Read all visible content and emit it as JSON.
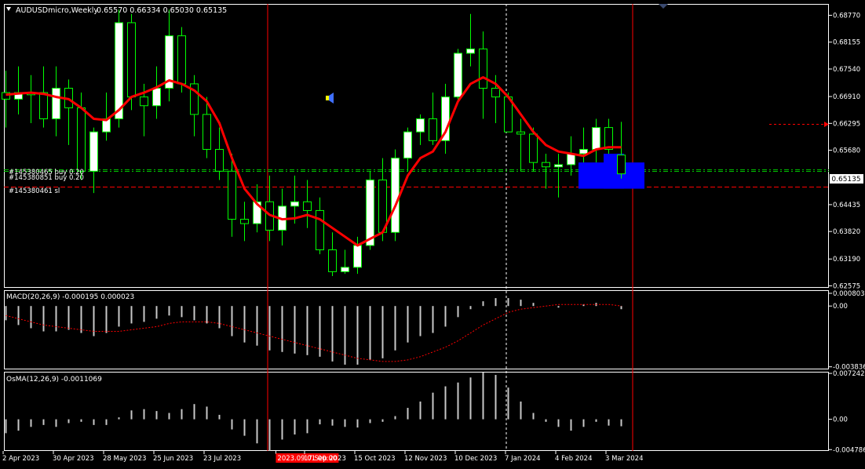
{
  "window": {
    "symbol_header": "AUDUSDmicro,Weekly",
    "ohlc_header": "0.65570 0.66334 0.65030 0.65135",
    "current_price_label": "0.65135"
  },
  "colors": {
    "background": "#000000",
    "bull_candle": "#ffffff",
    "bear_candle": "#000000",
    "wick": "#00ff00",
    "ma_line": "#ff0000",
    "histogram": "#c8c8c8",
    "signal_line": "#ff0000",
    "order_box": "#0000ff",
    "grid_dash": "#ffffff"
  },
  "orders": [
    {
      "label": "#145380465 buy 0.20",
      "price": 0.6525
    },
    {
      "label": "#145380851 buy 0.20",
      "price": 0.652
    },
    {
      "label": "#145380461 sl",
      "price": 0.6485
    }
  ],
  "chart_data": [
    {
      "type": "candlestick",
      "title": "AUDUSDmicro,Weekly",
      "y_ticks": [
        "0.68770",
        "0.68155",
        "0.67540",
        "0.66910",
        "0.66295",
        "0.65680",
        "0.64435",
        "0.63820",
        "0.63190",
        "0.62575"
      ],
      "ylim": [
        0.6253,
        0.6903
      ],
      "x_ticks": [
        "2 Apr 2023",
        "30 Apr 2023",
        "28 May 2023",
        "25 Jun 2023",
        "23 Jul 2023",
        "2023.09.01 00:00",
        "17 Sep 2023",
        "15 Oct 2023",
        "12 Nov 2023",
        "10 Dec 2023",
        "7 Jan 2024",
        "4 Feb 2024",
        "3 Mar 2024"
      ],
      "x_tick_dates": [
        "2023-04-02",
        "2023-04-30",
        "2023-05-28",
        "2023-06-25",
        "2023-07-23",
        "2023-09-01",
        "2023-09-17",
        "2023-10-15",
        "2023-11-12",
        "2023-12-10",
        "2024-01-07",
        "2024-02-04",
        "2024-03-03"
      ],
      "highlighted_x_tick": "2023.09.01 00:00",
      "current_price": 0.65135,
      "candles": [
        [
          0.67,
          0.675,
          0.662,
          0.6685
        ],
        [
          0.6685,
          0.676,
          0.665,
          0.67
        ],
        [
          0.67,
          0.674,
          0.663,
          0.6695
        ],
        [
          0.67,
          0.676,
          0.662,
          0.664
        ],
        [
          0.664,
          0.676,
          0.66,
          0.671
        ],
        [
          0.671,
          0.673,
          0.658,
          0.6665
        ],
        [
          0.6665,
          0.67,
          0.65,
          0.652
        ],
        [
          0.652,
          0.662,
          0.647,
          0.661
        ],
        [
          0.661,
          0.67,
          0.659,
          0.664
        ],
        [
          0.664,
          0.689,
          0.662,
          0.686
        ],
        [
          0.686,
          0.688,
          0.666,
          0.669
        ],
        [
          0.669,
          0.672,
          0.66,
          0.667
        ],
        [
          0.667,
          0.676,
          0.664,
          0.671
        ],
        [
          0.671,
          0.689,
          0.668,
          0.683
        ],
        [
          0.683,
          0.685,
          0.67,
          0.672
        ],
        [
          0.672,
          0.674,
          0.66,
          0.665
        ],
        [
          0.665,
          0.669,
          0.655,
          0.657
        ],
        [
          0.657,
          0.662,
          0.65,
          0.652
        ],
        [
          0.652,
          0.656,
          0.637,
          0.641
        ],
        [
          0.641,
          0.645,
          0.636,
          0.64
        ],
        [
          0.64,
          0.649,
          0.638,
          0.645
        ],
        [
          0.645,
          0.651,
          0.636,
          0.6385
        ],
        [
          0.6385,
          0.648,
          0.635,
          0.644
        ],
        [
          0.644,
          0.651,
          0.64,
          0.645
        ],
        [
          0.645,
          0.65,
          0.639,
          0.643
        ],
        [
          0.643,
          0.646,
          0.633,
          0.634
        ],
        [
          0.634,
          0.638,
          0.628,
          0.629
        ],
        [
          0.629,
          0.634,
          0.6285,
          0.63
        ],
        [
          0.63,
          0.637,
          0.6285,
          0.635
        ],
        [
          0.635,
          0.652,
          0.634,
          0.65
        ],
        [
          0.65,
          0.655,
          0.636,
          0.638
        ],
        [
          0.638,
          0.657,
          0.636,
          0.655
        ],
        [
          0.655,
          0.662,
          0.652,
          0.661
        ],
        [
          0.661,
          0.665,
          0.658,
          0.664
        ],
        [
          0.664,
          0.67,
          0.658,
          0.659
        ],
        [
          0.659,
          0.672,
          0.656,
          0.669
        ],
        [
          0.669,
          0.68,
          0.668,
          0.679
        ],
        [
          0.679,
          0.688,
          0.676,
          0.68
        ],
        [
          0.68,
          0.684,
          0.664,
          0.671
        ],
        [
          0.671,
          0.674,
          0.663,
          0.669
        ],
        [
          0.669,
          0.67,
          0.661,
          0.661
        ],
        [
          0.661,
          0.664,
          0.652,
          0.6605
        ],
        [
          0.6605,
          0.662,
          0.652,
          0.654
        ],
        [
          0.654,
          0.656,
          0.648,
          0.653
        ],
        [
          0.653,
          0.656,
          0.646,
          0.6535
        ],
        [
          0.6535,
          0.66,
          0.651,
          0.656
        ],
        [
          0.656,
          0.662,
          0.654,
          0.657
        ],
        [
          0.657,
          0.664,
          0.654,
          0.662
        ],
        [
          0.662,
          0.664,
          0.656,
          0.657
        ],
        [
          0.6557,
          0.6633,
          0.6503,
          0.6514
        ]
      ],
      "ma_series": {
        "name": "",
        "values": [
          0.6695,
          0.6698,
          0.67,
          0.6697,
          0.669,
          0.6685,
          0.6665,
          0.664,
          0.6637,
          0.666,
          0.669,
          0.67,
          0.6712,
          0.6728,
          0.672,
          0.6705,
          0.668,
          0.663,
          0.655,
          0.648,
          0.6445,
          0.642,
          0.641,
          0.6412,
          0.642,
          0.641,
          0.639,
          0.637,
          0.635,
          0.6365,
          0.638,
          0.644,
          0.651,
          0.655,
          0.6565,
          0.661,
          0.668,
          0.672,
          0.6735,
          0.672,
          0.669,
          0.665,
          0.661,
          0.658,
          0.6565,
          0.656,
          0.6555,
          0.657,
          0.6575,
          0.6575
        ]
      }
    },
    {
      "type": "bar",
      "title": "MACD(20,26,9) -0.000195 0.000023",
      "y_ticks": [
        "0.000803",
        "0.00",
        "-0.003836"
      ],
      "ylim": [
        -0.004,
        0.001
      ],
      "series": [
        {
          "name": "MACD",
          "values": [
            -0.0009,
            -0.0012,
            -0.0014,
            -0.0016,
            -0.0016,
            -0.0015,
            -0.0017,
            -0.0019,
            -0.0017,
            -0.0013,
            -0.0011,
            -0.001,
            -0.0008,
            -0.0006,
            -0.0007,
            -0.0009,
            -0.0011,
            -0.0014,
            -0.0019,
            -0.0023,
            -0.0025,
            -0.0028,
            -0.0029,
            -0.003,
            -0.0031,
            -0.0032,
            -0.0035,
            -0.0037,
            -0.0037,
            -0.0034,
            -0.0033,
            -0.0028,
            -0.0023,
            -0.0019,
            -0.0017,
            -0.0013,
            -0.0007,
            -0.0002,
            0.0003,
            0.0005,
            0.0005,
            0.0004,
            0.0002,
            0.0,
            -0.0001,
            0.0,
            0.0001,
            0.0002,
            0.0,
            -0.0002
          ]
        },
        {
          "name": "Signal",
          "values": [
            -0.0006,
            -0.0008,
            -0.001,
            -0.0012,
            -0.0013,
            -0.0014,
            -0.0015,
            -0.0016,
            -0.0016,
            -0.0016,
            -0.0015,
            -0.0014,
            -0.0013,
            -0.0011,
            -0.001,
            -0.001,
            -0.001,
            -0.0011,
            -0.0013,
            -0.0015,
            -0.0017,
            -0.0019,
            -0.0021,
            -0.0023,
            -0.0025,
            -0.0027,
            -0.0029,
            -0.0031,
            -0.0033,
            -0.0034,
            -0.0035,
            -0.0035,
            -0.0034,
            -0.0032,
            -0.0029,
            -0.0026,
            -0.0022,
            -0.0017,
            -0.0012,
            -0.0008,
            -0.0004,
            -0.0002,
            -0.0001,
            0.0,
            0.0001,
            0.0001,
            0.0001,
            0.0001,
            0.0001,
            0.0
          ]
        }
      ]
    },
    {
      "type": "bar",
      "title": "OsMA(12,26,9) -0.0011069",
      "y_ticks": [
        "0.007242",
        "0.00",
        "-0.004786"
      ],
      "ylim": [
        -0.005,
        0.0075
      ],
      "series": [
        {
          "name": "OsMA",
          "values": [
            -0.0022,
            -0.0018,
            -0.0012,
            -0.0009,
            -0.0012,
            -0.0006,
            -0.0004,
            -0.0009,
            -0.0009,
            0.0003,
            0.0014,
            0.0016,
            0.0013,
            0.001,
            0.0016,
            0.0024,
            0.002,
            0.0007,
            -0.0016,
            -0.0026,
            -0.0038,
            -0.005,
            -0.0032,
            -0.0024,
            -0.0022,
            -0.0008,
            -0.001,
            -0.0012,
            -0.0013,
            -0.0006,
            -0.0004,
            0.0005,
            0.0018,
            0.0028,
            0.0042,
            0.0052,
            0.0058,
            0.0066,
            0.0074,
            0.007,
            0.005,
            0.0028,
            0.001,
            -0.0004,
            -0.0012,
            -0.0018,
            -0.0012,
            -0.0004,
            -0.001,
            -0.0011
          ]
        }
      ]
    }
  ]
}
